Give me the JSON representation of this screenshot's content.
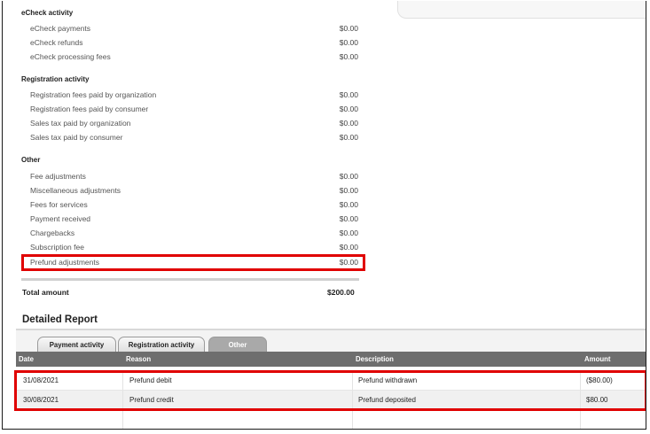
{
  "summary": {
    "echeck": {
      "title": "eCheck activity",
      "items": [
        {
          "label": "eCheck payments",
          "amount": "$0.00"
        },
        {
          "label": "eCheck refunds",
          "amount": "$0.00"
        },
        {
          "label": "eCheck processing fees",
          "amount": "$0.00"
        }
      ]
    },
    "registration": {
      "title": "Registration activity",
      "items": [
        {
          "label": "Registration fees paid by organization",
          "amount": "$0.00"
        },
        {
          "label": "Registration fees paid by consumer",
          "amount": "$0.00"
        },
        {
          "label": "Sales tax paid by organization",
          "amount": "$0.00"
        },
        {
          "label": "Sales tax paid by consumer",
          "amount": "$0.00"
        }
      ]
    },
    "other": {
      "title": "Other",
      "items": [
        {
          "label": "Fee adjustments",
          "amount": "$0.00"
        },
        {
          "label": "Miscellaneous adjustments",
          "amount": "$0.00"
        },
        {
          "label": "Fees for services",
          "amount": "$0.00"
        },
        {
          "label": "Payment received",
          "amount": "$0.00"
        },
        {
          "label": "Chargebacks",
          "amount": "$0.00"
        },
        {
          "label": "Subscription fee",
          "amount": "$0.00"
        },
        {
          "label": "Prefund adjustments",
          "amount": "$0.00"
        }
      ]
    },
    "total": {
      "label": "Total amount",
      "amount": "$200.00"
    }
  },
  "report": {
    "title": "Detailed Report",
    "tabs": [
      {
        "label": "Payment activity",
        "active": false
      },
      {
        "label": "Registration activity",
        "active": false
      },
      {
        "label": "Other",
        "active": true
      }
    ],
    "columns": [
      "Date",
      "Reason",
      "Description",
      "Amount"
    ],
    "rows": [
      {
        "date": "31/08/2021",
        "reason": "Prefund debit",
        "description": "Prefund withdrawn",
        "amount": "($80.00)"
      },
      {
        "date": "30/08/2021",
        "reason": "Prefund credit",
        "description": "Prefund deposited",
        "amount": "$80.00"
      }
    ]
  },
  "colors": {
    "highlight": "#e00000",
    "header_bg": "#6e6e6e",
    "active_tab": "#a9a9a9"
  }
}
